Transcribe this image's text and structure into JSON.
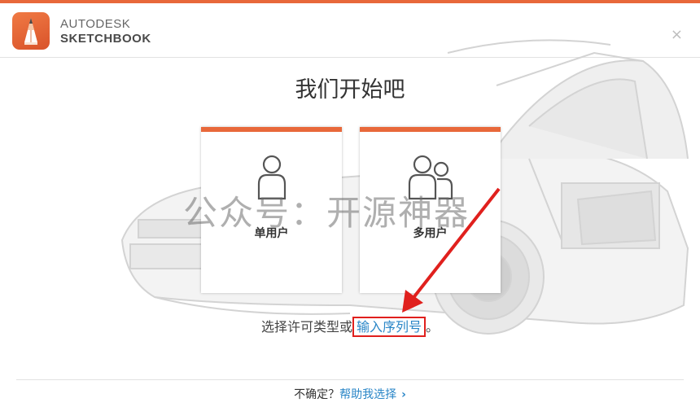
{
  "window": {
    "brand_line1": "AUTODESK",
    "brand_line2": "SKETCHBOOK",
    "close_label": "×",
    "accent_color": "#e8683a"
  },
  "main": {
    "title": "我们开始吧",
    "cards": [
      {
        "label": "单用户",
        "icon": "single-user-icon"
      },
      {
        "label": "多用户",
        "icon": "multi-user-icon"
      }
    ],
    "license_prefix": "选择许可类型或",
    "serial_link": "输入序列号",
    "license_suffix": "。"
  },
  "watermark": "公众号：开源神器",
  "footer": {
    "prefix": "不确定？",
    "help_link": "帮助我选择",
    "chevron": "›"
  },
  "annotation": {
    "highlight_color": "#e0201d"
  }
}
